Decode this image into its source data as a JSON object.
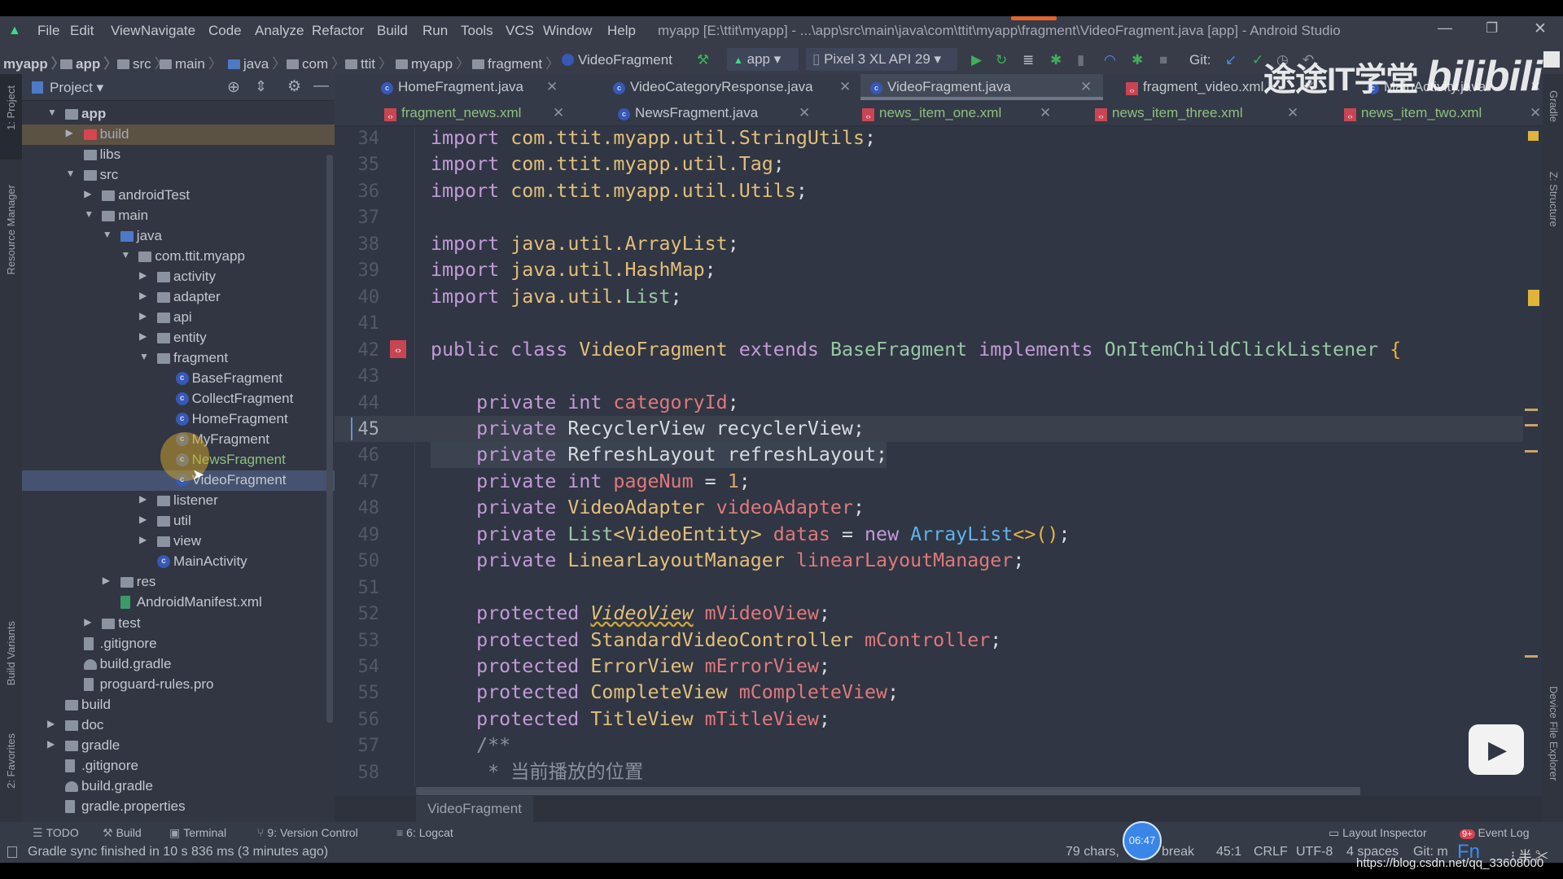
{
  "menu": {
    "items": [
      "File",
      "Edit",
      "View",
      "Navigate",
      "Code",
      "Analyze",
      "Refactor",
      "Build",
      "Run",
      "Tools",
      "VCS",
      "Window",
      "Help"
    ],
    "window_title": "myapp [E:\\ttit\\myapp] - ...\\app\\src\\main\\java\\com\\ttit\\myapp\\fragment\\VideoFragment.java [app] - Android Studio"
  },
  "breadcrumb": [
    "myapp",
    "app",
    "src",
    "main",
    "java",
    "com",
    "ttit",
    "myapp",
    "fragment",
    "VideoFragment"
  ],
  "toolbar": {
    "run_config": "app",
    "device": "Pixel 3 XL API 29",
    "git_label": "Git:"
  },
  "watermark": {
    "channel": "途途IT学堂",
    "brand": "bilibili",
    "url": "https://blog.csdn.net/qq_33608000"
  },
  "side_tools": {
    "left": [
      "1: Project",
      "Resource Manager",
      "Build Variants",
      "2: Favorites"
    ],
    "right": [
      "Gradle",
      "Z: Structure",
      "Device File Explorer"
    ]
  },
  "project_panel": {
    "title": "Project",
    "tree": [
      {
        "label": "app",
        "depth": 0,
        "arrow": "down",
        "icon": "module",
        "bold": true
      },
      {
        "label": "build",
        "depth": 1,
        "arrow": "right",
        "icon": "folder-red",
        "highlight": "excluded"
      },
      {
        "label": "libs",
        "depth": 1,
        "arrow": "",
        "icon": "folder"
      },
      {
        "label": "src",
        "depth": 1,
        "arrow": "down",
        "icon": "folder"
      },
      {
        "label": "androidTest",
        "depth": 2,
        "arrow": "right",
        "icon": "folder"
      },
      {
        "label": "main",
        "depth": 2,
        "arrow": "down",
        "icon": "folder"
      },
      {
        "label": "java",
        "depth": 3,
        "arrow": "down",
        "icon": "folder-blue"
      },
      {
        "label": "com.ttit.myapp",
        "depth": 4,
        "arrow": "down",
        "icon": "package"
      },
      {
        "label": "activity",
        "depth": 5,
        "arrow": "right",
        "icon": "package"
      },
      {
        "label": "adapter",
        "depth": 5,
        "arrow": "right",
        "icon": "package"
      },
      {
        "label": "api",
        "depth": 5,
        "arrow": "right",
        "icon": "package"
      },
      {
        "label": "entity",
        "depth": 5,
        "arrow": "right",
        "icon": "package"
      },
      {
        "label": "fragment",
        "depth": 5,
        "arrow": "down",
        "icon": "package"
      },
      {
        "label": "BaseFragment",
        "depth": 6,
        "arrow": "",
        "icon": "class"
      },
      {
        "label": "CollectFragment",
        "depth": 6,
        "arrow": "",
        "icon": "class"
      },
      {
        "label": "HomeFragment",
        "depth": 6,
        "arrow": "",
        "icon": "class"
      },
      {
        "label": "MyFragment",
        "depth": 6,
        "arrow": "",
        "icon": "class"
      },
      {
        "label": "NewsFragment",
        "depth": 6,
        "arrow": "",
        "icon": "class",
        "color": "#8fc07f"
      },
      {
        "label": "VideoFragment",
        "depth": 6,
        "arrow": "",
        "icon": "class",
        "highlight": "selected"
      },
      {
        "label": "listener",
        "depth": 5,
        "arrow": "right",
        "icon": "package"
      },
      {
        "label": "util",
        "depth": 5,
        "arrow": "right",
        "icon": "package"
      },
      {
        "label": "view",
        "depth": 5,
        "arrow": "right",
        "icon": "package"
      },
      {
        "label": "MainActivity",
        "depth": 5,
        "arrow": "",
        "icon": "class"
      },
      {
        "label": "res",
        "depth": 3,
        "arrow": "right",
        "icon": "folder"
      },
      {
        "label": "AndroidManifest.xml",
        "depth": 3,
        "arrow": "",
        "icon": "manifest"
      },
      {
        "label": "test",
        "depth": 2,
        "arrow": "right",
        "icon": "folder"
      },
      {
        "label": ".gitignore",
        "depth": 1,
        "arrow": "",
        "icon": "file"
      },
      {
        "label": "build.gradle",
        "depth": 1,
        "arrow": "",
        "icon": "gradle"
      },
      {
        "label": "proguard-rules.pro",
        "depth": 1,
        "arrow": "",
        "icon": "file"
      },
      {
        "label": "build",
        "depth": 0,
        "arrow": "",
        "icon": "folder"
      },
      {
        "label": "doc",
        "depth": 0,
        "arrow": "right",
        "icon": "folder"
      },
      {
        "label": "gradle",
        "depth": 0,
        "arrow": "right",
        "icon": "folder"
      },
      {
        "label": ".gitignore",
        "depth": 0,
        "arrow": "",
        "icon": "file"
      },
      {
        "label": "build.gradle",
        "depth": 0,
        "arrow": "",
        "icon": "gradle"
      },
      {
        "label": "gradle.properties",
        "depth": 0,
        "arrow": "",
        "icon": "file"
      }
    ]
  },
  "editor": {
    "tabs_row1": [
      {
        "label": "HomeFragment.java",
        "type": "java"
      },
      {
        "label": "VideoCategoryResponse.java",
        "type": "java"
      },
      {
        "label": "VideoFragment.java",
        "type": "java",
        "active": true
      },
      {
        "label": "fragment_video.xml",
        "type": "xml"
      },
      {
        "label": "MainActivity.java",
        "type": "java"
      }
    ],
    "tabs_row2": [
      {
        "label": "fragment_news.xml",
        "type": "xml"
      },
      {
        "label": "NewsFragment.java",
        "type": "java"
      },
      {
        "label": "news_item_one.xml",
        "type": "xml"
      },
      {
        "label": "news_item_three.xml",
        "type": "xml"
      },
      {
        "label": "news_item_two.xml",
        "type": "xml"
      }
    ],
    "current_line": 45,
    "lines": [
      {
        "n": 34,
        "t": [
          [
            "import ",
            "kw"
          ],
          [
            "com.ttit.myapp.util.StringUtils",
            "ty"
          ],
          [
            ";",
            ""
          ]
        ]
      },
      {
        "n": 35,
        "t": [
          [
            "import ",
            "kw"
          ],
          [
            "com.ttit.myapp.util.Tag",
            "ty"
          ],
          [
            ";",
            ""
          ]
        ]
      },
      {
        "n": 36,
        "t": [
          [
            "import ",
            "kw"
          ],
          [
            "com.ttit.myapp.util.Utils",
            "ty"
          ],
          [
            ";",
            ""
          ]
        ]
      },
      {
        "n": 37,
        "t": []
      },
      {
        "n": 38,
        "t": [
          [
            "import ",
            "kw"
          ],
          [
            "java.util.ArrayList",
            "ty"
          ],
          [
            ";",
            ""
          ]
        ]
      },
      {
        "n": 39,
        "t": [
          [
            "import ",
            "kw"
          ],
          [
            "java.util.HashMap",
            "ty"
          ],
          [
            ";",
            ""
          ]
        ]
      },
      {
        "n": 40,
        "t": [
          [
            "import ",
            "kw"
          ],
          [
            "java.util.",
            "ty"
          ],
          [
            "List",
            "gn"
          ],
          [
            ";",
            ""
          ]
        ]
      },
      {
        "n": 41,
        "t": []
      },
      {
        "n": 42,
        "t": [
          [
            "public class ",
            "kw"
          ],
          [
            "VideoFragment ",
            "ty"
          ],
          [
            "extends ",
            "kw"
          ],
          [
            "BaseFragment ",
            "gn"
          ],
          [
            "implements ",
            "kw"
          ],
          [
            "OnItemChildClickListener ",
            "gn"
          ],
          [
            "{",
            "br"
          ]
        ]
      },
      {
        "n": 43,
        "t": []
      },
      {
        "n": 44,
        "t": [
          [
            "    private int ",
            "kw"
          ],
          [
            "categoryId",
            "fd"
          ],
          [
            ";",
            ""
          ]
        ]
      },
      {
        "n": 45,
        "t": [
          [
            "    private ",
            "kw"
          ],
          [
            "RecyclerView recyclerView;",
            ""
          ]
        ]
      },
      {
        "n": 46,
        "t": [
          [
            "    private ",
            "kw"
          ],
          [
            "RefreshLayout refreshLayout;",
            ""
          ]
        ]
      },
      {
        "n": 47,
        "t": [
          [
            "    private int ",
            "kw"
          ],
          [
            "pageNum ",
            "fd"
          ],
          [
            "= ",
            ""
          ],
          [
            "1",
            "nm"
          ],
          [
            ";",
            ""
          ]
        ]
      },
      {
        "n": 48,
        "t": [
          [
            "    private ",
            "kw"
          ],
          [
            "VideoAdapter ",
            "ty"
          ],
          [
            "videoAdapter",
            "fd"
          ],
          [
            ";",
            ""
          ]
        ]
      },
      {
        "n": 49,
        "t": [
          [
            "    private ",
            "kw"
          ],
          [
            "List",
            "gn"
          ],
          [
            "<VideoEntity> ",
            "ty"
          ],
          [
            "datas ",
            "fd"
          ],
          [
            "= ",
            ""
          ],
          [
            "new ",
            "kw"
          ],
          [
            "ArrayList",
            "bl"
          ],
          [
            "<>()",
            "br"
          ],
          [
            ";",
            ""
          ]
        ]
      },
      {
        "n": 50,
        "t": [
          [
            "    private ",
            "kw"
          ],
          [
            "LinearLayoutManager ",
            "ty"
          ],
          [
            "linearLayoutManager",
            "fd"
          ],
          [
            ";",
            ""
          ]
        ]
      },
      {
        "n": 51,
        "t": []
      },
      {
        "n": 52,
        "t": [
          [
            "    protected ",
            "kw"
          ],
          [
            "VideoView",
            "ty it"
          ],
          [
            " ",
            ""
          ],
          [
            "mVideoView",
            "fd"
          ],
          [
            ";",
            ""
          ]
        ]
      },
      {
        "n": 53,
        "t": [
          [
            "    protected ",
            "kw"
          ],
          [
            "StandardVideoController ",
            "ty"
          ],
          [
            "mController",
            "fd"
          ],
          [
            ";",
            ""
          ]
        ]
      },
      {
        "n": 54,
        "t": [
          [
            "    protected ",
            "kw"
          ],
          [
            "ErrorView ",
            "ty"
          ],
          [
            "mErrorView",
            "fd"
          ],
          [
            ";",
            ""
          ]
        ]
      },
      {
        "n": 55,
        "t": [
          [
            "    protected ",
            "kw"
          ],
          [
            "CompleteView ",
            "ty"
          ],
          [
            "mCompleteView",
            "fd"
          ],
          [
            ";",
            ""
          ]
        ]
      },
      {
        "n": 56,
        "t": [
          [
            "    protected ",
            "kw"
          ],
          [
            "TitleView ",
            "ty"
          ],
          [
            "mTitleView",
            "fd"
          ],
          [
            ";",
            ""
          ]
        ]
      },
      {
        "n": 57,
        "t": [
          [
            "    /**",
            "cm"
          ]
        ]
      },
      {
        "n": 58,
        "t": [
          [
            "     * 当前播放的位置",
            "cm"
          ]
        ]
      }
    ],
    "breadcrumb": "VideoFragment"
  },
  "bottom_tools": [
    "TODO",
    "Build",
    "Terminal",
    "9: Version Control",
    "6: Logcat"
  ],
  "bottom_right_tools": {
    "layout_inspector": "Layout Inspector",
    "event_log": "Event Log",
    "event_badge": "9+"
  },
  "status": {
    "message": "Gradle sync finished in 10 s 836 ms (3 minutes ago)",
    "selection_a": "79 chars,",
    "selection_b": "break",
    "position": "45:1",
    "line_sep": "CRLF",
    "encoding": "UTF-8",
    "indent": "4 spaces",
    "git": "Git: m",
    "ime": "Fn"
  },
  "clock": "06:47",
  "colors": {
    "accent": "#3758b5",
    "keyword": "#c39ad9",
    "type": "#e3bf7a",
    "field": "#e0787c",
    "run_green": "#3fae5a"
  }
}
